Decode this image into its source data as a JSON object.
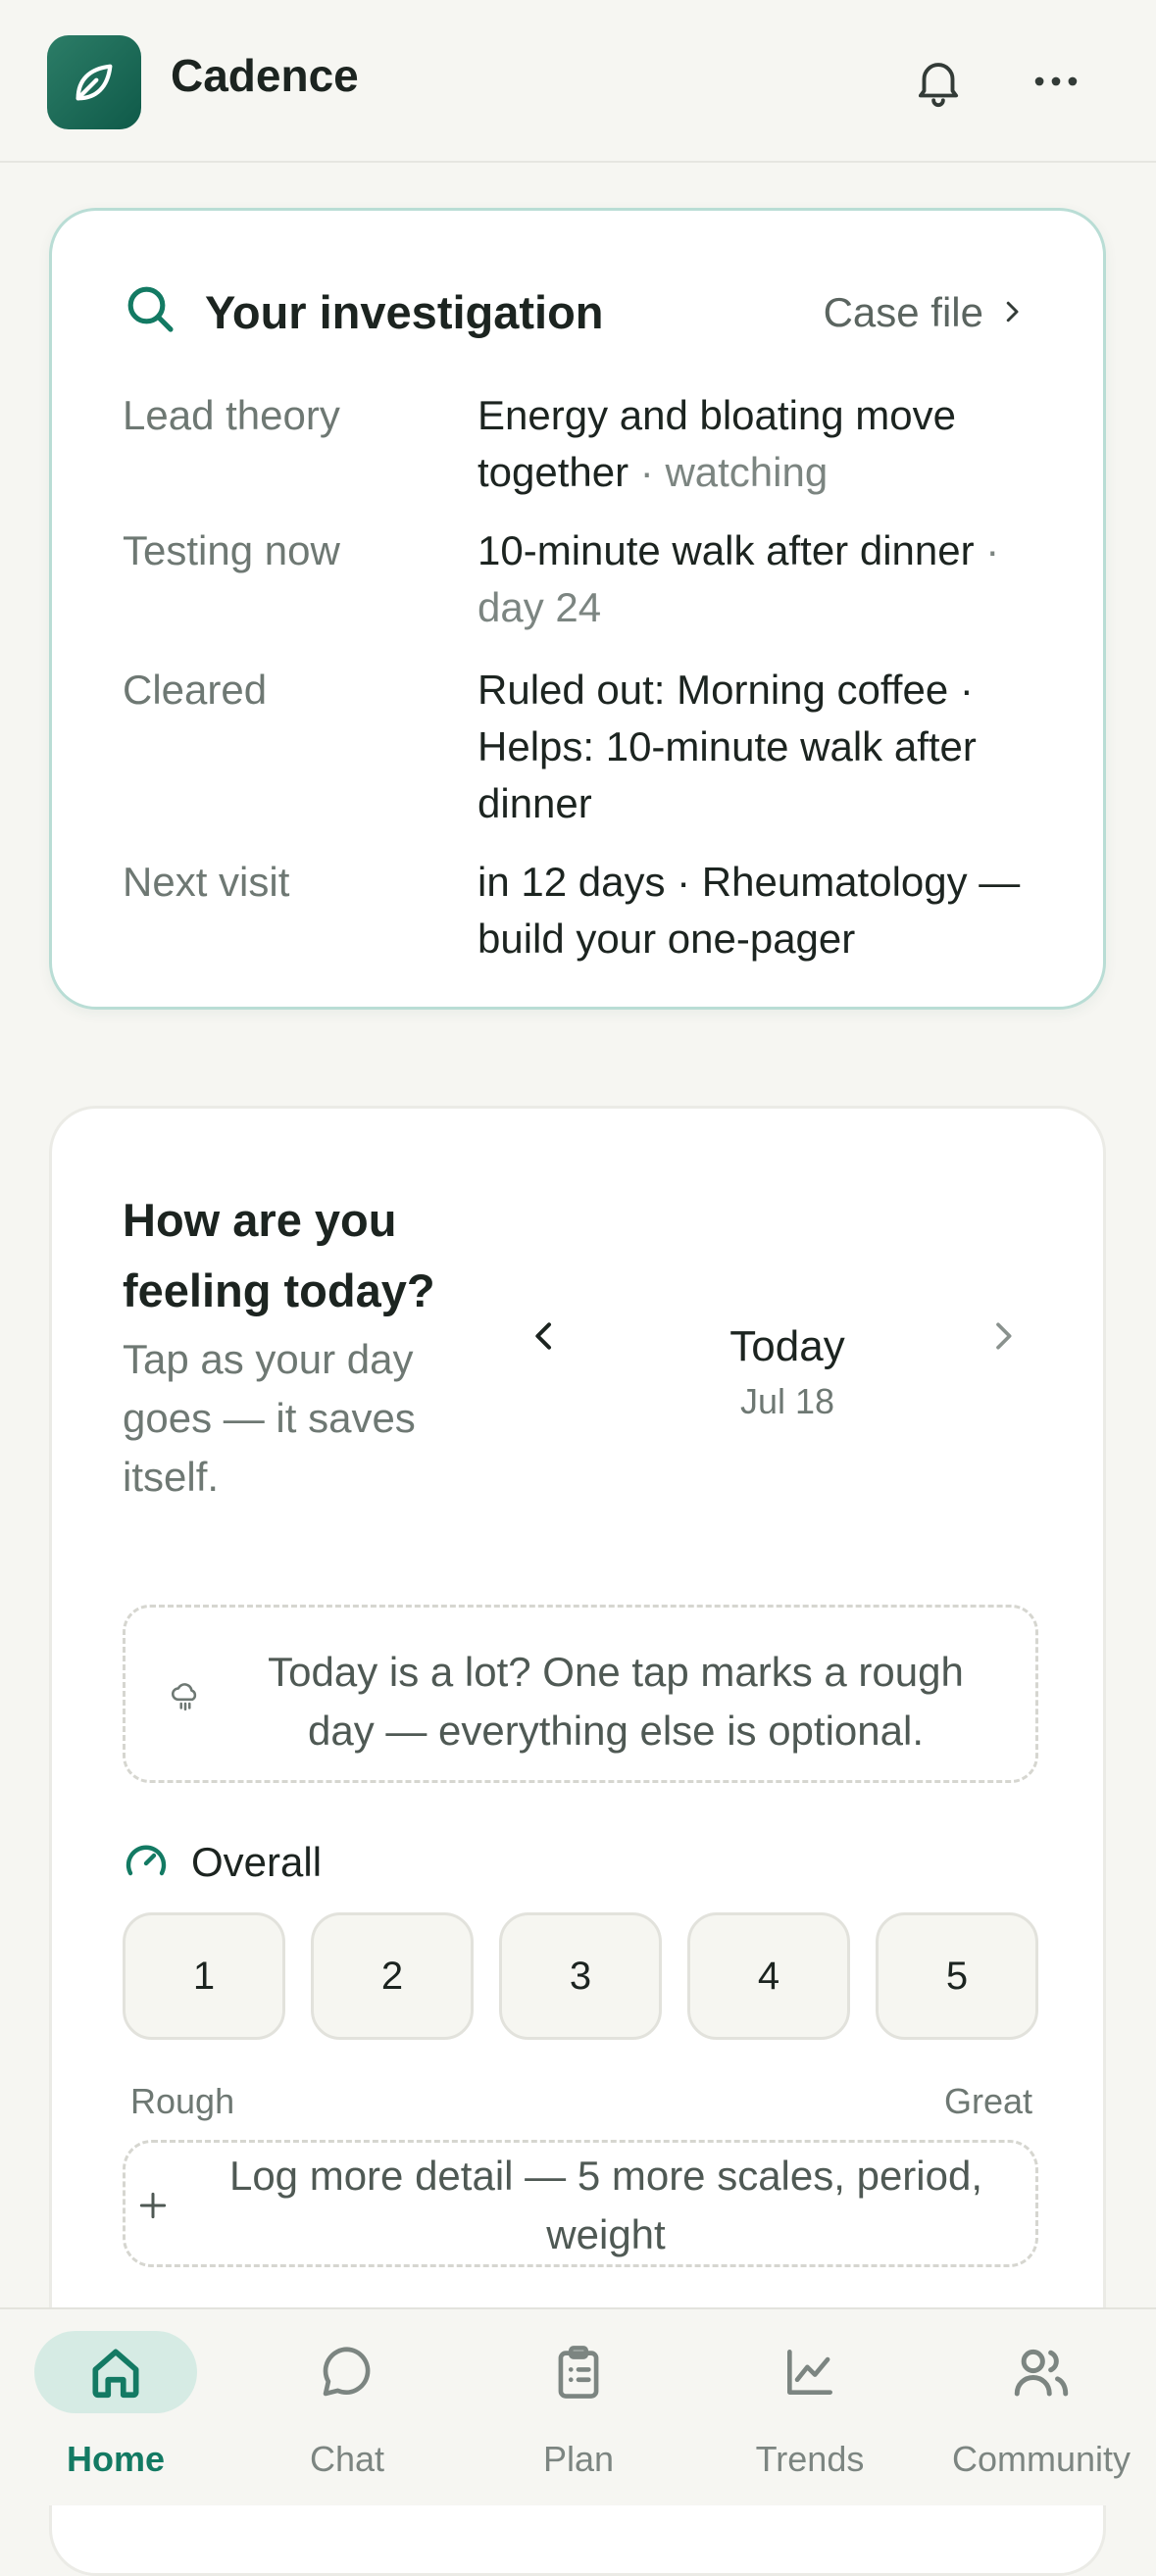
{
  "app": {
    "name": "Cadence"
  },
  "colors": {
    "accent": "#137a63",
    "accent_light": "#d6ebe4",
    "card_border": "#b9ddd5",
    "background": "#f6f6f2"
  },
  "icons": {
    "logo": "leaf-icon",
    "notifications": "bell-icon",
    "more": "more-horizontal-icon",
    "investigation": "search-icon",
    "case_file": "chevron-right-icon",
    "rough_day": "rain-cloud-icon",
    "overall": "gauge-icon",
    "add": "plus-icon"
  },
  "investigation": {
    "title": "Your investigation",
    "case_file_label": "Case file",
    "rows": [
      {
        "label": "Lead theory",
        "value": "Energy and bloating move together",
        "note": " · watching"
      },
      {
        "label": "Testing now",
        "value": "10-minute walk after dinner",
        "note": " · day 24"
      },
      {
        "label": "Cleared",
        "value": "Ruled out: Morning coffee · Helps: 10-minute walk after dinner",
        "note": ""
      },
      {
        "label": "Next visit",
        "value": "in 12 days · Rheumatology — build your one-pager",
        "note": ""
      }
    ]
  },
  "checkin": {
    "title": "How are you feeling today?",
    "subtitle": "Tap as your day goes — it saves itself.",
    "date_label": "Today",
    "date": "Jul 18",
    "rough_day_text": "Today is a lot? One tap marks a rough day — everything else is optional.",
    "overall_label": "Overall",
    "scale": [
      "1",
      "2",
      "3",
      "4",
      "5"
    ],
    "scale_low": "Rough",
    "scale_high": "Great",
    "more_detail": "Log more detail — 5 more scales, period, weight"
  },
  "nav": {
    "active": "Home",
    "items": [
      {
        "label": "Home",
        "icon": "home-icon"
      },
      {
        "label": "Chat",
        "icon": "chat-bubble-icon"
      },
      {
        "label": "Plan",
        "icon": "clipboard-icon"
      },
      {
        "label": "Trends",
        "icon": "line-chart-icon"
      },
      {
        "label": "Community",
        "icon": "users-icon"
      }
    ]
  }
}
